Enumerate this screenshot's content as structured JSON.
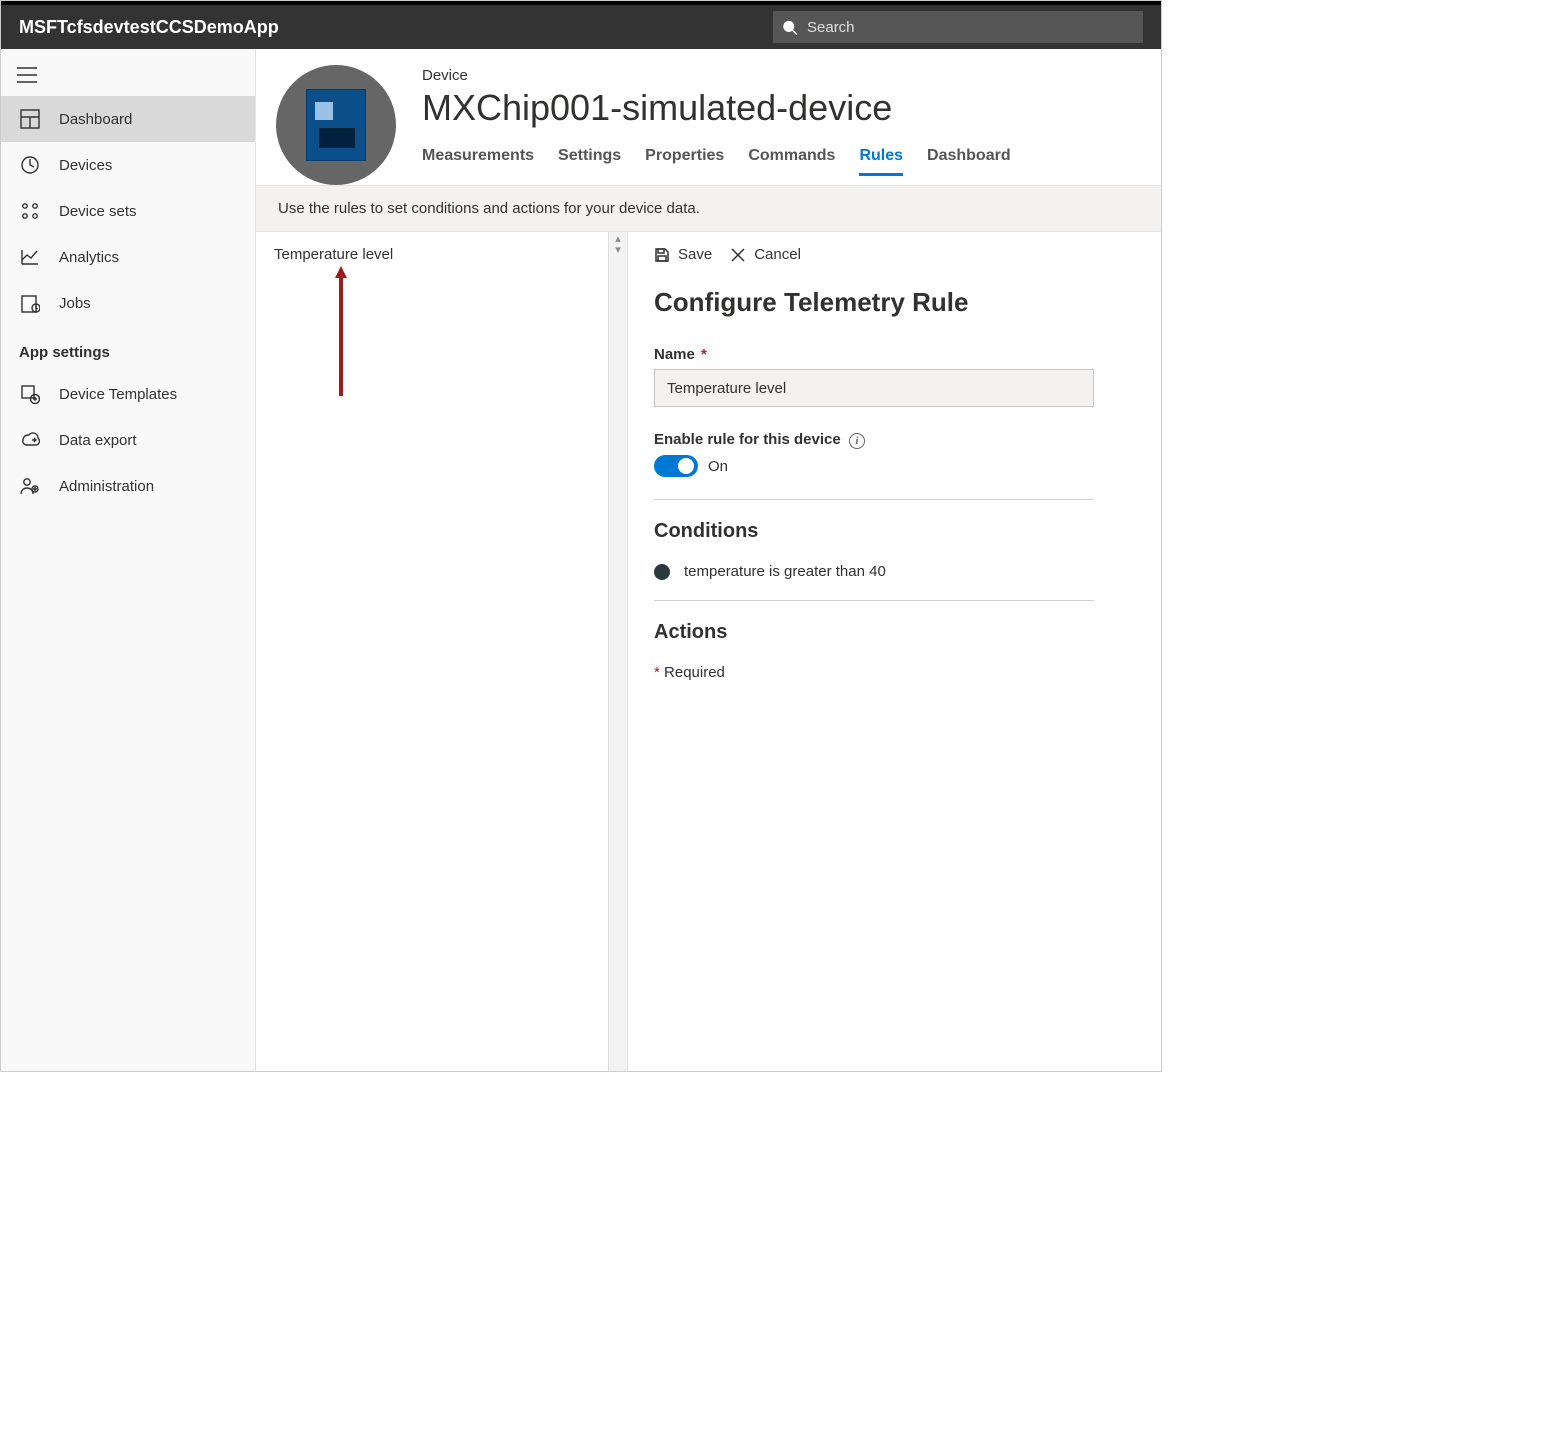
{
  "topbar": {
    "title": "MSFTcfsdevtestCCSDemoApp",
    "search_placeholder": "Search"
  },
  "sidebar": {
    "items": [
      {
        "label": "Dashboard"
      },
      {
        "label": "Devices"
      },
      {
        "label": "Device sets"
      },
      {
        "label": "Analytics"
      },
      {
        "label": "Jobs"
      }
    ],
    "section_label": "App settings",
    "settings_items": [
      {
        "label": "Device Templates"
      },
      {
        "label": "Data export"
      },
      {
        "label": "Administration"
      }
    ]
  },
  "device": {
    "kicker": "Device",
    "title": "MXChip001-simulated-device",
    "tabs": [
      {
        "label": "Measurements"
      },
      {
        "label": "Settings"
      },
      {
        "label": "Properties"
      },
      {
        "label": "Commands"
      },
      {
        "label": "Rules"
      },
      {
        "label": "Dashboard"
      }
    ]
  },
  "rules_banner": "Use the rules to set conditions and actions for your device data.",
  "rule_list": {
    "items": [
      {
        "label": "Temperature level"
      }
    ]
  },
  "toolbar": {
    "save": "Save",
    "cancel": "Cancel"
  },
  "form": {
    "title": "Configure Telemetry Rule",
    "name_label": "Name",
    "name_value": "Temperature level",
    "enable_label": "Enable rule for this device",
    "toggle_value": "On",
    "conditions_label": "Conditions",
    "condition_text": "temperature is greater than 40",
    "actions_label": "Actions",
    "required_note": "Required"
  }
}
